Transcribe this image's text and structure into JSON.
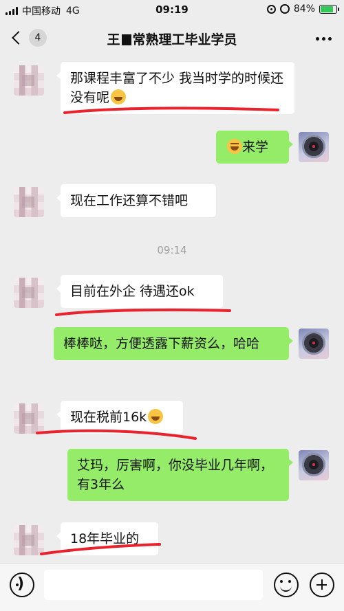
{
  "status_bar": {
    "carrier": "中国移动",
    "network": "4G",
    "time": "09:19",
    "battery_percent": "84%",
    "battery_level": 0.84
  },
  "nav": {
    "unread_count": "4",
    "title_prefix": "王",
    "title_suffix": "常熟理工毕业学员"
  },
  "messages": [
    {
      "from": "contact",
      "text": "那课程丰富了不少 我当时学的时候还没有呢",
      "emoji": "laughing-emoji"
    },
    {
      "from": "me",
      "text": "来学",
      "emoji": "wink-emoji"
    },
    {
      "from": "contact",
      "text": "现在工作还算不错吧"
    },
    {
      "from": "contact",
      "text": "目前在外企 待遇还ok"
    },
    {
      "from": "me",
      "text": "棒棒哒，方便透露下薪资么，哈哈"
    },
    {
      "from": "contact",
      "text": "现在税前16k",
      "emoji": "laughing-emoji"
    },
    {
      "from": "me",
      "text": "艾玛，厉害啊，你没毕业几年啊，有3年么"
    },
    {
      "from": "contact",
      "text": "18年毕业的"
    }
  ],
  "timestamp": "09:14",
  "colors": {
    "chat_background": "#ededed",
    "outgoing_bubble": "#95ec69",
    "incoming_bubble": "#ffffff",
    "annotation_red": "#e8232e"
  },
  "icons": [
    "back-chevron-icon",
    "more-icon",
    "voice-icon",
    "emoji-icon",
    "plus-icon",
    "signal-icon",
    "rotation-lock-icon",
    "alarm-icon",
    "battery-icon"
  ]
}
